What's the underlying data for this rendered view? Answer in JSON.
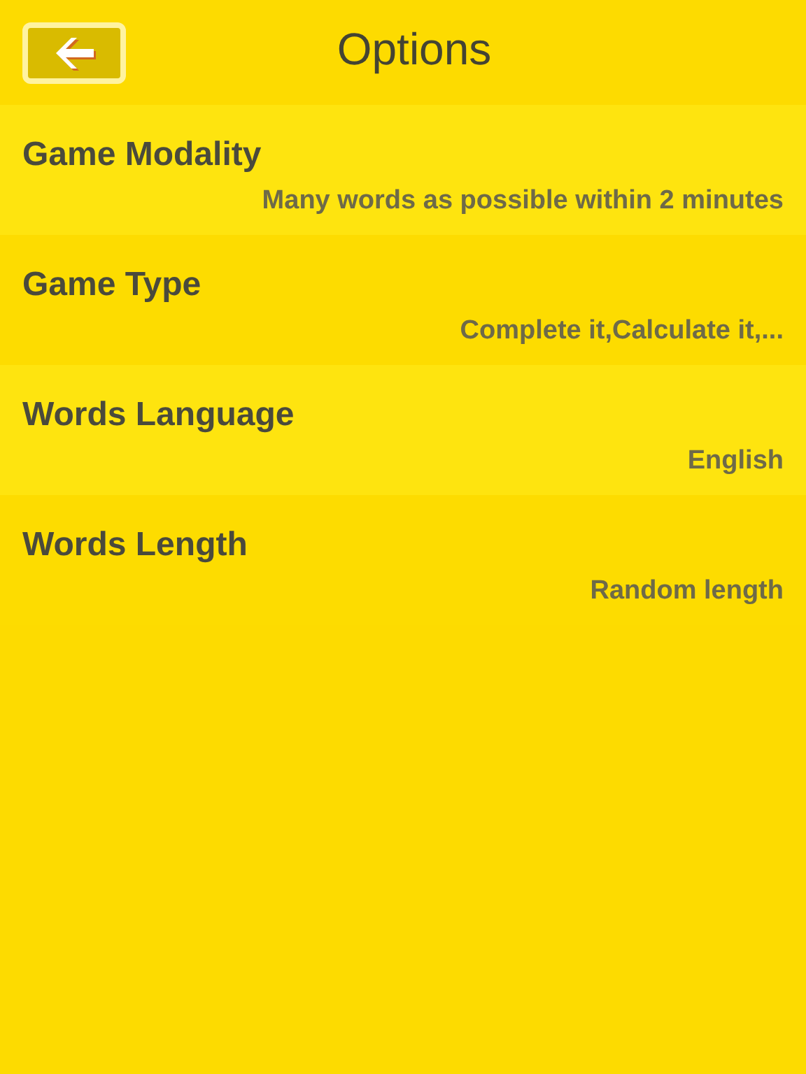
{
  "header": {
    "title": "Options"
  },
  "options": [
    {
      "label": "Game Modality",
      "value": "Many words as possible within 2 minutes"
    },
    {
      "label": "Game Type",
      "value": "Complete it,Calculate it,..."
    },
    {
      "label": "Words Language",
      "value": "English"
    },
    {
      "label": "Words Length",
      "value": "Random length"
    }
  ]
}
